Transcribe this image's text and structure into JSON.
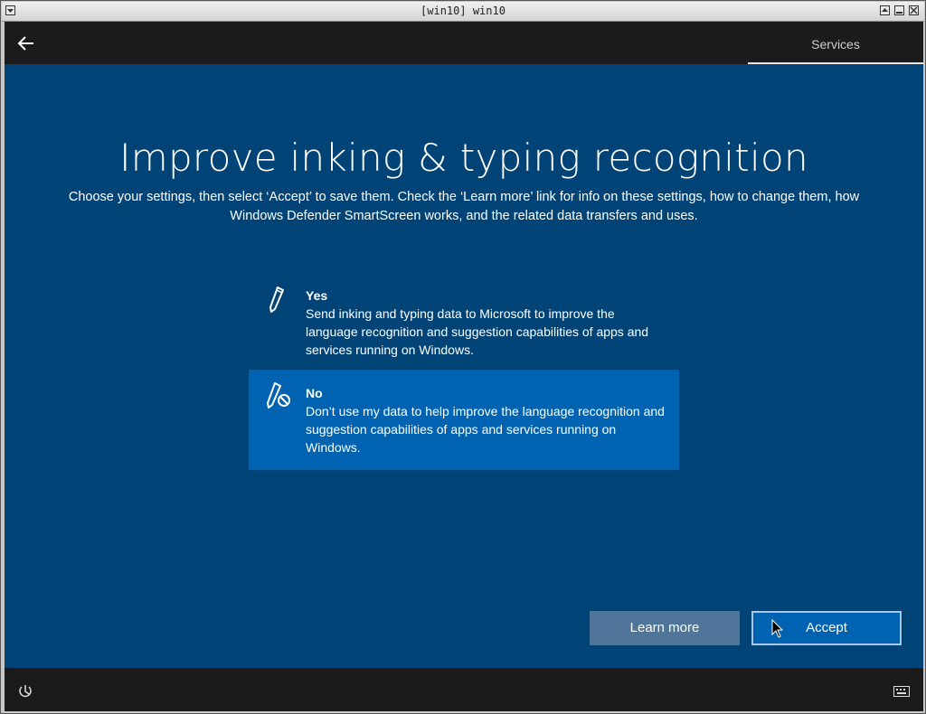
{
  "window": {
    "title": "[win10] win10"
  },
  "topbar": {
    "active_tab": "Services"
  },
  "page": {
    "heading": "Improve inking & typing recognition",
    "intro": "Choose your settings, then select ‘Accept’ to save them. Check the ‘Learn more’ link for info on these settings, how to change them, how Windows Defender SmartScreen works, and the related data transfers and uses."
  },
  "options": [
    {
      "label": "Yes",
      "description": "Send inking and typing data to Microsoft to improve the language recognition and suggestion capabilities of apps and services running on Windows.",
      "icon": "pen-icon",
      "selected": false
    },
    {
      "label": "No",
      "description": "Don’t use my data to help improve the language recognition and suggestion capabilities of apps and services running on Windows.",
      "icon": "pen-blocked-icon",
      "selected": true
    }
  ],
  "buttons": {
    "learn_more": "Learn more",
    "accept": "Accept"
  },
  "colors": {
    "background": "#004477",
    "bar": "#1b1b1b",
    "selected_option": "#0063b1",
    "secondary_button": "#4f759a",
    "primary_button": "#0063b1"
  },
  "icons": {
    "back": "back-arrow-icon",
    "ease_of_access": "ease-of-access-icon",
    "keyboard": "keyboard-icon"
  }
}
